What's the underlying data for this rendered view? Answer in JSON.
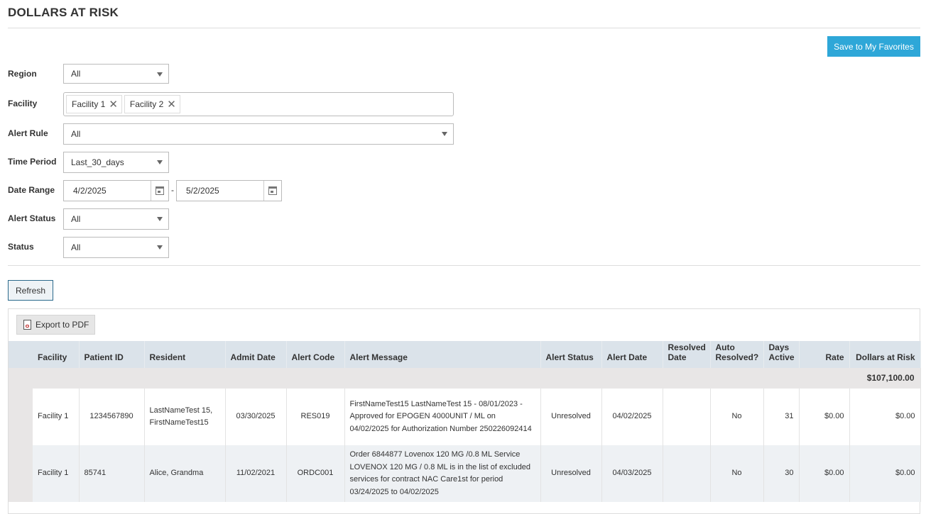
{
  "page": {
    "title": "DOLLARS AT RISK"
  },
  "actions": {
    "save_favorites": "Save to My Favorites",
    "refresh": "Refresh",
    "export_pdf": "Export to PDF"
  },
  "filters": {
    "region": {
      "label": "Region",
      "value": "All"
    },
    "facility": {
      "label": "Facility",
      "tags": [
        "Facility 1",
        "Facility 2"
      ]
    },
    "alert_rule": {
      "label": "Alert Rule",
      "value": "All"
    },
    "time_period": {
      "label": "Time Period",
      "value": "Last_30_days"
    },
    "date_range": {
      "label": "Date Range",
      "from": "4/2/2025",
      "separator": "-",
      "to": "5/2/2025"
    },
    "alert_status": {
      "label": "Alert Status",
      "value": "All"
    },
    "status": {
      "label": "Status",
      "value": "All"
    }
  },
  "table": {
    "columns": {
      "facility": "Facility",
      "patient_id": "Patient ID",
      "resident": "Resident",
      "admit_date": "Admit Date",
      "alert_code": "Alert Code",
      "alert_message": "Alert Message",
      "alert_status": "Alert Status",
      "alert_date": "Alert Date",
      "resolved_date": "Resolved Date",
      "auto_resolved": "Auto Resolved?",
      "days_active": "Days Active",
      "rate": "Rate",
      "dollars_at_risk": "Dollars at Risk"
    },
    "total": "$107,100.00",
    "rows": [
      {
        "facility": "Facility 1",
        "patient_id": "1234567890",
        "resident": "LastNameTest 15, FirstNameTest15",
        "admit_date": "03/30/2025",
        "alert_code": "RES019",
        "alert_message": "FirstNameTest15 LastNameTest 15 - 08/01/2023 - Approved for EPOGEN 4000UNIT / ML on 04/02/2025 for Authorization Number 250226092414",
        "alert_status": "Unresolved",
        "alert_date": "04/02/2025",
        "resolved_date": "",
        "auto_resolved": "No",
        "days_active": "31",
        "rate": "$0.00",
        "dollars_at_risk": "$0.00"
      },
      {
        "facility": "Facility 1",
        "patient_id": "85741",
        "resident": "Alice, Grandma",
        "admit_date": "11/02/2021",
        "alert_code": "ORDC001",
        "alert_message": "Order 6844877 Lovenox 120 MG /0.8 ML Service LOVENOX 120 MG / 0.8 ML is in the list of excluded services for contract NAC Care1st for period 03/24/2025 to 04/02/2025",
        "alert_status": "Unresolved",
        "alert_date": "04/03/2025",
        "resolved_date": "",
        "auto_resolved": "No",
        "days_active": "30",
        "rate": "$0.00",
        "dollars_at_risk": "$0.00"
      }
    ]
  }
}
